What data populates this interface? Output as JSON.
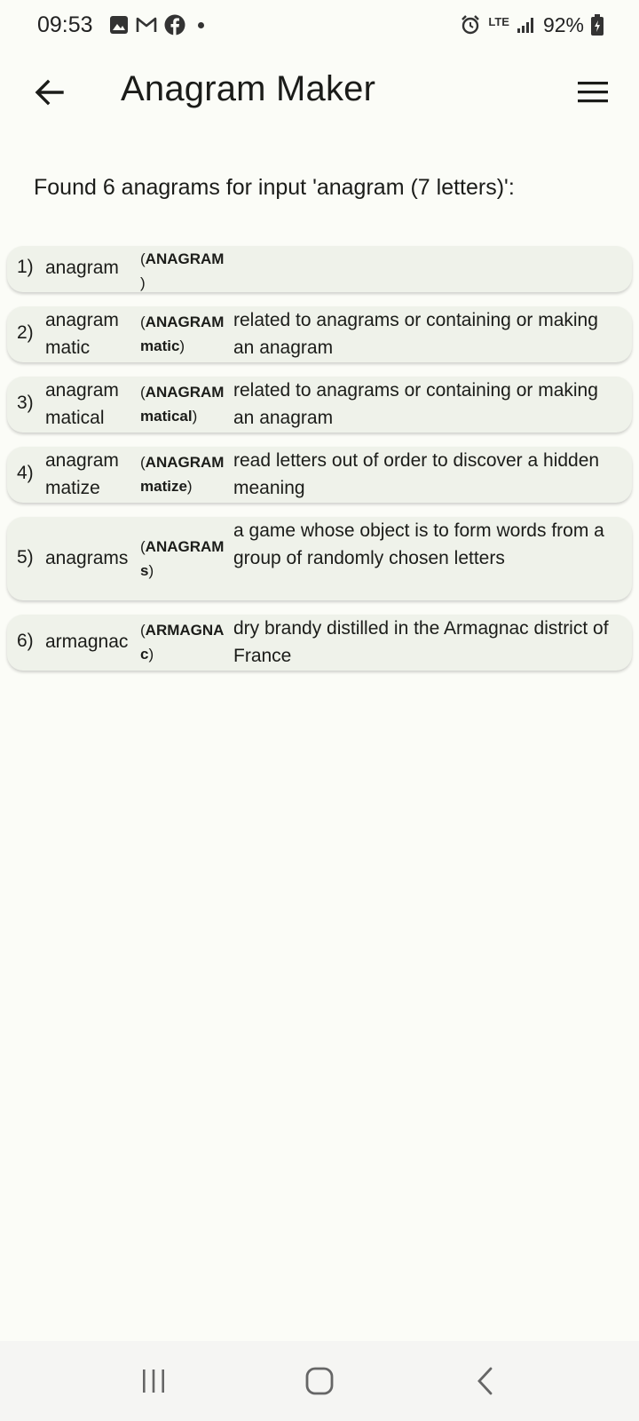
{
  "status": {
    "time": "09:53",
    "battery": "92%",
    "network": "LTE",
    "icons": [
      "gallery-icon",
      "gmail-icon",
      "facebook-icon",
      "alarm-icon",
      "signal-icon",
      "battery-icon"
    ]
  },
  "app_bar": {
    "title": "Anagram Maker"
  },
  "summary": "Found 6 anagrams for input 'anagram (7 letters)':",
  "results": [
    {
      "index": "1)",
      "word": "anagram",
      "upper_bold": "ANAGRAM",
      "upper_rest": "",
      "definition": ""
    },
    {
      "index": "2)",
      "word": "anagrammatic",
      "upper_bold": "ANAGRAM",
      "upper_rest": "matic",
      "definition": "related to anagrams or containing or making an anagram"
    },
    {
      "index": "3)",
      "word": "anagrammatical",
      "upper_bold": "ANAGRAM",
      "upper_rest": "matical",
      "definition": "related to anagrams or containing or making an anagram"
    },
    {
      "index": "4)",
      "word": "anagrammatize",
      "upper_bold": "ANAGRAM",
      "upper_rest": "matize",
      "definition": "read letters out of order to discover a hidden meaning"
    },
    {
      "index": "5)",
      "word": "anagrams",
      "upper_bold": "ANAGRAM",
      "upper_rest": "s",
      "definition": "a game whose object is to form words from a group of randomly chosen letters"
    },
    {
      "index": "6)",
      "word": "armagnac",
      "upper_bold": "ARMAGNA",
      "upper_rest": "c",
      "definition": "dry brandy distilled in the Armagnac district of France"
    }
  ]
}
